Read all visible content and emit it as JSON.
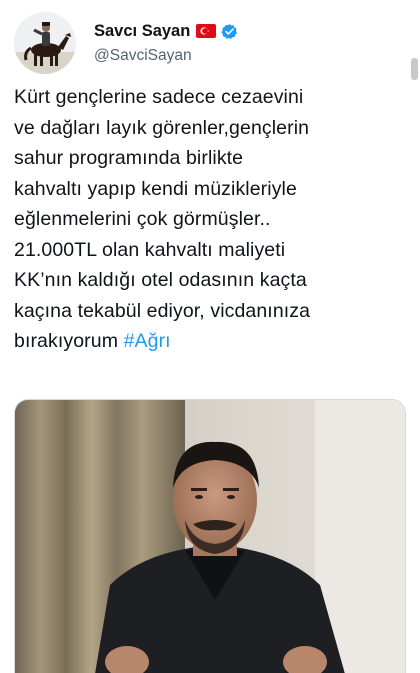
{
  "tweet": {
    "author": {
      "display_name": "Savcı Sayan",
      "handle": "@SavciSayan",
      "flag_icon": "turkey-flag-icon",
      "verified_icon": "verified-badge-icon",
      "verified_color": "#1d9bf0"
    },
    "text": "Kürt gençlerine sadece cezaevini\nve dağları layık görenler,gençlerin\nsahur programında birlikte\nkahvaltı yapıp kendi müzikleriyle\neğlenmelerini çok görmüşler..\n21.000TL olan kahvaltı maliyeti\nKK’nın kaldığı otel odasının kaçta\nkaçına tekabül ediyor, vicdanınıza\nbırakıyorum ",
    "hashtag": "#Ağrı",
    "hashtag_color": "#1d9bf0"
  }
}
